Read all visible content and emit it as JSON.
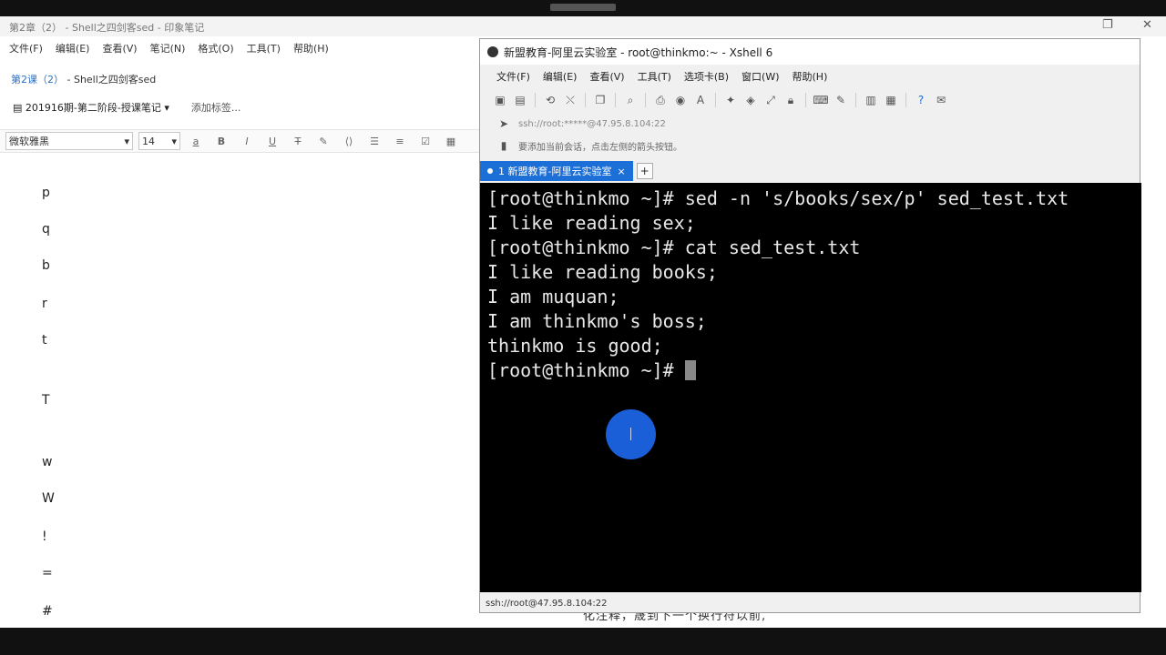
{
  "note_app": {
    "title": "第2章（2） - Shell之四剑客sed - 印象笔记",
    "menu": [
      "文件(F)",
      "编辑(E)",
      "查看(V)",
      "笔记(N)",
      "格式(O)",
      "工具(T)",
      "帮助(H)"
    ],
    "doc_title_prefix": "第2课（2）",
    "doc_title_suffix": " - Shell之四剑客sed",
    "notebook": "201916期-第二阶段-授课笔记",
    "add_tag": "添加标签...",
    "font_name": "微软雅黑",
    "font_size": "14",
    "letters": [
      "p",
      "q",
      "b",
      "r",
      "t",
      "T",
      "w",
      "W",
      "!",
      "=",
      "#"
    ],
    "caption": "化注释，晟到下一个换行符以前,"
  },
  "xshell": {
    "title": "新盟教育-阿里云实验室 - root@thinkmo:~ - Xshell 6",
    "menu": [
      "文件(F)",
      "编辑(E)",
      "查看(V)",
      "工具(T)",
      "选项卡(B)",
      "窗口(W)",
      "帮助(H)"
    ],
    "address": "ssh://root:*****@47.95.8.104:22",
    "hint": "要添加当前会话，点击左侧的箭头按钮。",
    "tab_label": "1 新盟教育-阿里云实验室",
    "tab_add": "+",
    "terminal_lines": [
      "[root@thinkmo ~]# sed -n 's/books/sex/p' sed_test.txt",
      "I like reading sex;",
      "[root@thinkmo ~]# cat sed_test.txt",
      "I like reading books;",
      "I am muquan;",
      "I am thinkmo's boss;",
      "thinkmo is good;"
    ],
    "prompt": "[root@thinkmo ~]# ",
    "status": "ssh://root@47.95.8.104:22"
  },
  "colors": {
    "tab_active": "#1c6fd6",
    "terminal_bg": "#000000",
    "terminal_fg": "#e8e8e8",
    "click_indicator": "#1a5fd8"
  }
}
